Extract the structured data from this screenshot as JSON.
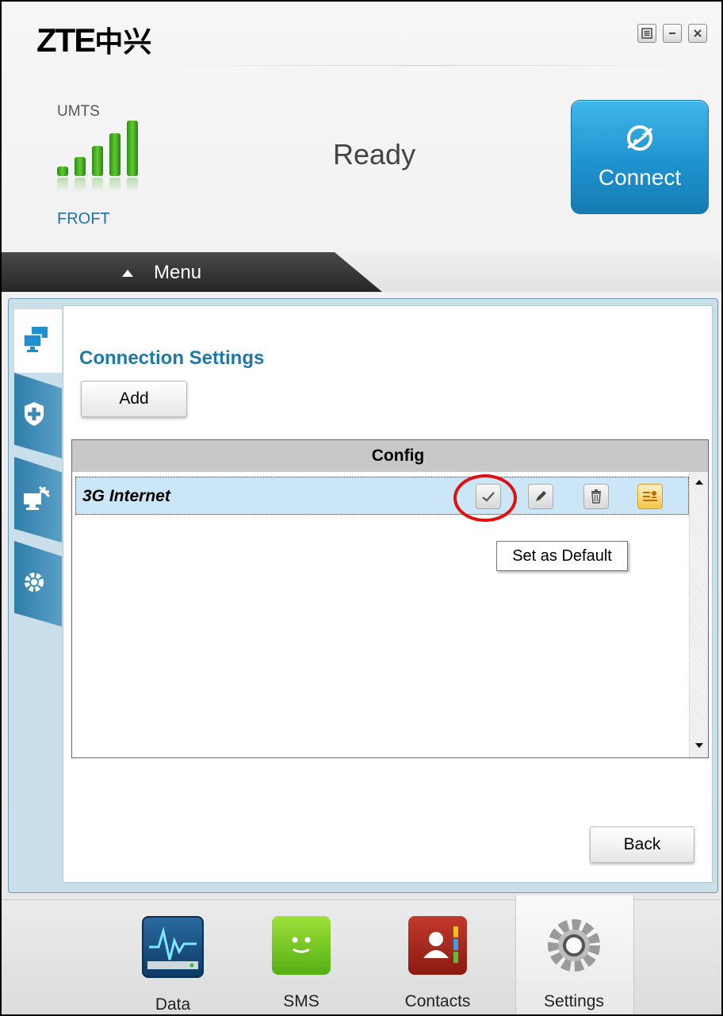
{
  "app": {
    "logo_latin": "ZTE",
    "logo_chinese": "中兴",
    "window_buttons": [
      "menu-icon",
      "minimize-icon",
      "close-icon"
    ]
  },
  "status_panel": {
    "network_type": "UMTS",
    "signal_bars_filled": 5,
    "signal_bars_total": 5,
    "operator": "FROFT",
    "status_text": "Ready",
    "connect_label": "Connect"
  },
  "menu": {
    "label": "Menu"
  },
  "side_tabs": [
    "network-settings-icon",
    "security-icon",
    "network-select-icon",
    "advanced-settings-icon"
  ],
  "settings": {
    "title": "Connection Settings",
    "add_label": "Add",
    "table_header": "Config",
    "profiles": [
      {
        "name": "3G Internet",
        "actions": [
          "checkmark-icon",
          "edit-icon",
          "trash-icon",
          "profile-icon"
        ]
      }
    ],
    "tooltip": "Set as Default",
    "back_label": "Back"
  },
  "bottom_nav": [
    {
      "label": "Data",
      "icon": "data-monitor-icon",
      "selected": false
    },
    {
      "label": "SMS",
      "icon": "sms-icon",
      "selected": false
    },
    {
      "label": "Contacts",
      "icon": "contacts-book-icon",
      "selected": false
    },
    {
      "label": "Settings",
      "icon": "settings-gear-icon",
      "selected": true
    }
  ],
  "colors": {
    "accent": "#1f78a6",
    "connect_button": "#1f93cf",
    "signal": "#3aa81f",
    "selected_row": "#cbe6f6",
    "highlight_ring": "#e01010"
  }
}
